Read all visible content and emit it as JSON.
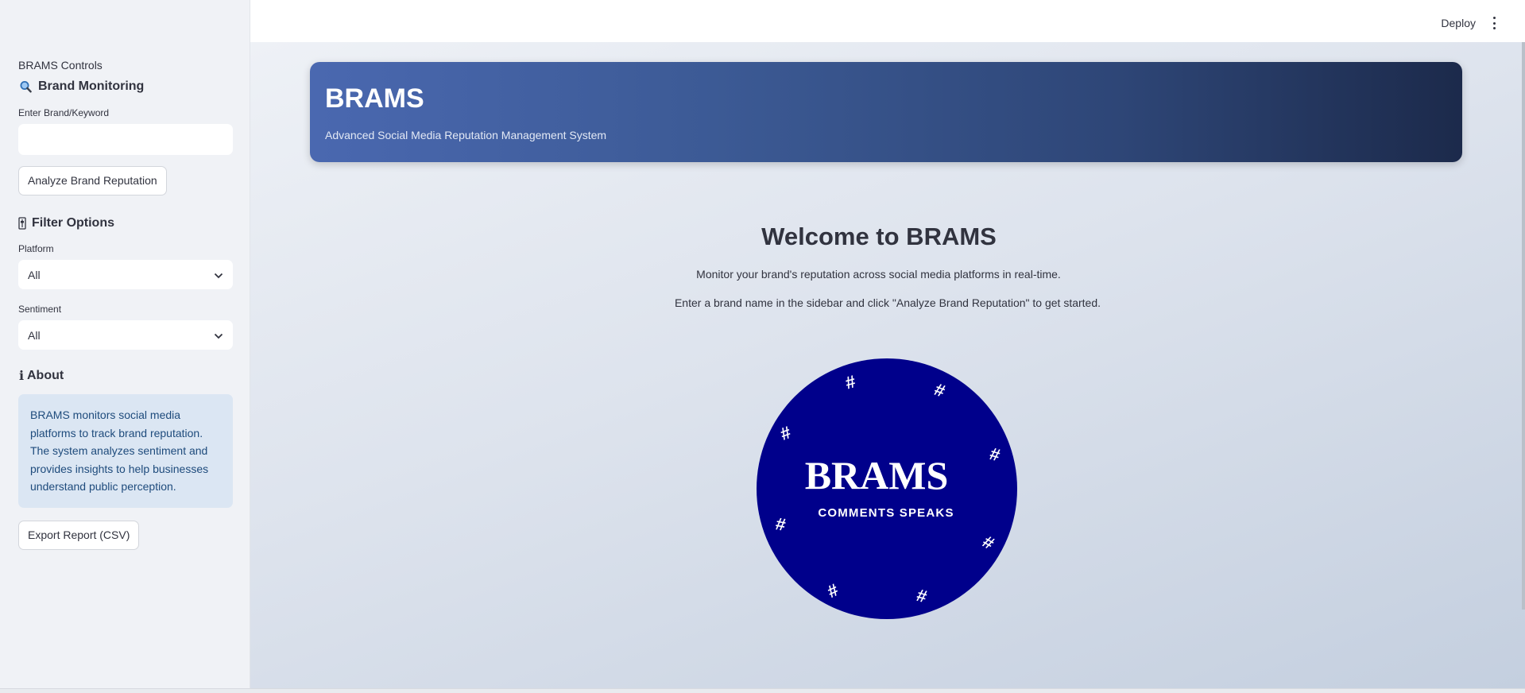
{
  "sidebar": {
    "caption": "BRAMS Controls",
    "brand_monitoring": {
      "icon": "magnifier-icon",
      "title": "Brand Monitoring"
    },
    "keyword_label": "Enter Brand/Keyword",
    "keyword_value": "",
    "analyze_button": "Analyze Brand Reputation",
    "filter": {
      "icon": "filter-icon",
      "title": "Filter Options"
    },
    "platform_label": "Platform",
    "platform_value": "All",
    "sentiment_label": "Sentiment",
    "sentiment_value": "All",
    "about": {
      "icon": "info-icon",
      "title": "About"
    },
    "about_text": "BRAMS monitors social media platforms to track brand reputation. The system analyzes sentiment and provides insights to help businesses understand public perception.",
    "export_button": "Export Report (CSV)"
  },
  "toolbar": {
    "deploy_label": "Deploy",
    "menu_icon": "kebab-menu-icon"
  },
  "hero": {
    "title": "BRAMS",
    "subtitle": "Advanced Social Media Reputation Management System"
  },
  "welcome": {
    "title": "Welcome to BRAMS",
    "line1": "Monitor your brand's reputation across social media platforms in real-time.",
    "line2": "Enter a brand name in the sidebar and click \"Analyze Brand Reputation\" to get started."
  },
  "logo": {
    "title": "BRAMS",
    "tagline": "COMMENTS SPEAKS",
    "symbol": "#",
    "bg_color": "#00008b"
  },
  "colors": {
    "sidebar_bg": "#f0f2f6",
    "hero_start": "#4a68b0",
    "hero_end": "#1c2a4b",
    "info_bg": "#dbe6f3",
    "info_text": "#1e4b7c"
  }
}
